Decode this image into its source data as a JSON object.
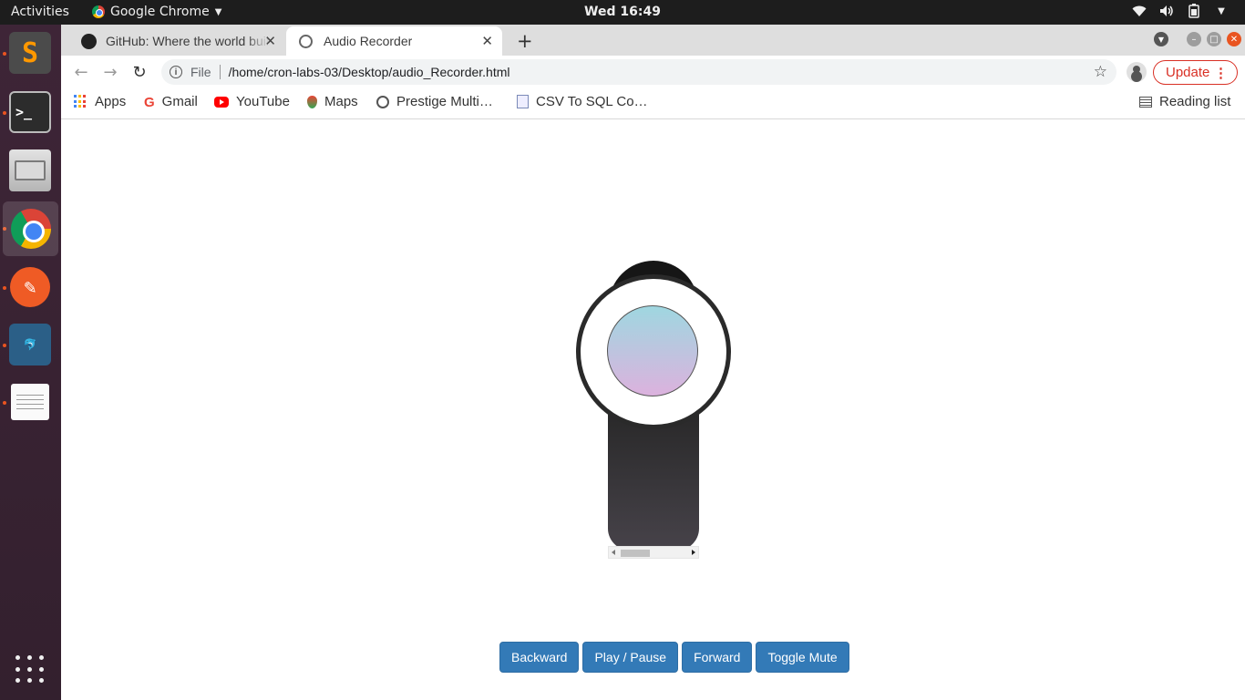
{
  "topbar": {
    "activities": "Activities",
    "app_name": "Google Chrome",
    "clock": "Wed 16:49",
    "tray_icons": [
      "wifi-icon",
      "volume-icon",
      "battery-icon",
      "system-menu-icon"
    ]
  },
  "dock": {
    "items": [
      {
        "name": "Sublime Text",
        "icon": "sublime-icon",
        "running": true
      },
      {
        "name": "Terminal",
        "icon": "terminal-icon",
        "running": true
      },
      {
        "name": "Files",
        "icon": "files-icon",
        "running": false
      },
      {
        "name": "Google Chrome",
        "icon": "chrome-icon",
        "running": true,
        "active": true
      },
      {
        "name": "Postman",
        "icon": "postman-icon",
        "running": true
      },
      {
        "name": "MySQL Workbench",
        "icon": "mysql-workbench-icon",
        "running": true
      },
      {
        "name": "Text Editor",
        "icon": "text-editor-icon",
        "running": true
      }
    ],
    "show_apps_icon": "apps-grid-icon"
  },
  "browser": {
    "tabs": [
      {
        "title": "GitHub: Where the world builds software",
        "icon": "github-icon",
        "active": false
      },
      {
        "title": "Audio Recorder",
        "icon": "globe-icon",
        "active": true
      }
    ],
    "url_scheme": "File",
    "url": "/home/cron-labs-03/Desktop/audio_Recorder.html",
    "update_label": "Update",
    "bookmarks": [
      {
        "label": "Apps",
        "icon": "apps-icon"
      },
      {
        "label": "Gmail",
        "icon": "google-icon"
      },
      {
        "label": "YouTube",
        "icon": "youtube-icon"
      },
      {
        "label": "Maps",
        "icon": "maps-icon"
      },
      {
        "label": "Prestige Multi…",
        "icon": "globe-icon"
      },
      {
        "label": "CSV To SQL Co…",
        "icon": "csv-icon"
      }
    ],
    "reading_list": "Reading list"
  },
  "page": {
    "controls": {
      "backward": "Backward",
      "play_pause": "Play / Pause",
      "forward": "Forward",
      "toggle_mute": "Toggle Mute"
    }
  },
  "colors": {
    "accent_button": "#337ab7",
    "update_red": "#d93025",
    "dock_bg": "#3a1f2f",
    "topbar_bg": "#1d1d1d"
  }
}
